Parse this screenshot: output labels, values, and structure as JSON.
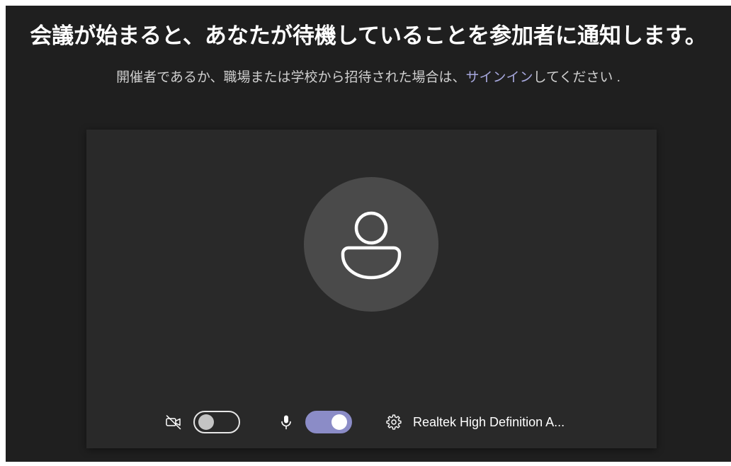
{
  "heading": "会議が始まると、あなたが待機していることを参加者に通知します。",
  "subtitle": {
    "before_link": "開催者であるか、職場または学校から招待された場合は、",
    "link": "サインイン",
    "after_link": "してください ."
  },
  "preview": {
    "avatar_icon": "person-icon"
  },
  "controls": {
    "camera": {
      "icon": "video-off-icon",
      "enabled": false
    },
    "mic": {
      "icon": "mic-icon",
      "enabled": true
    },
    "device_settings": {
      "icon": "gear-icon",
      "label": "Realtek High Definition A..."
    }
  },
  "colors": {
    "background": "#1f1f1f",
    "panel": "#292929",
    "avatar": "#4a4a4a",
    "accent": "#8b8cc7",
    "link": "#a6a7dc",
    "text": "#ffffff",
    "subtext": "#cfcfcf"
  }
}
